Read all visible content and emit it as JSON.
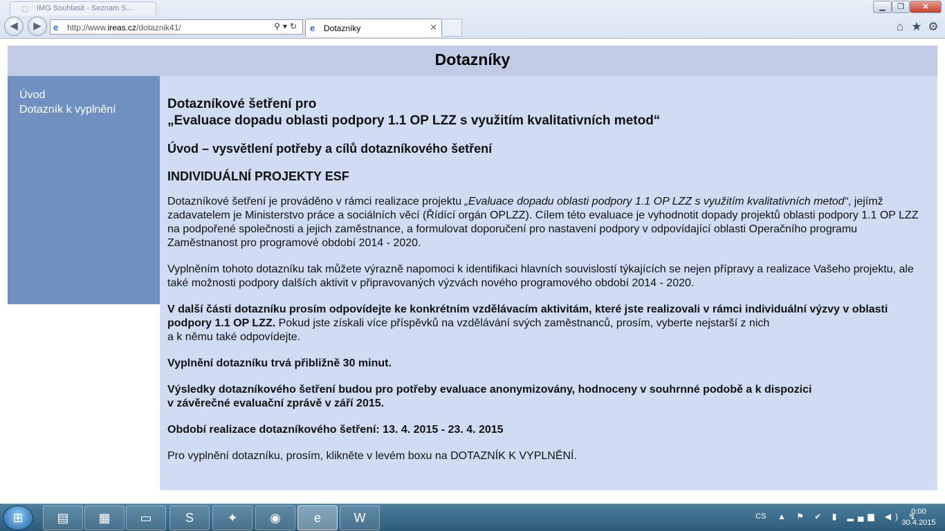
{
  "browser": {
    "ghost_tab_title": "IMG Souhlasit - Seznam S...",
    "address_bar": {
      "url_prefix": "http://www.",
      "url_domain": "ireas.cz",
      "url_path": "/dotaznik41/"
    },
    "active_tab": {
      "title": "Dotazníky",
      "close": "✕"
    },
    "window_buttons": {
      "minimize": "▁",
      "maximize": "❐",
      "close": "✕"
    },
    "nav": {
      "back": "◀",
      "forward": "▶"
    },
    "address_tools": "⚲▾↻",
    "icons": {
      "home": "⌂",
      "favorites": "★",
      "tools": "⚙",
      "favicon": "e"
    }
  },
  "page": {
    "title": "Dotazníky",
    "sidebar": {
      "items": [
        {
          "label": "Úvod"
        },
        {
          "label": "Dotazník k vyplnění"
        }
      ]
    },
    "content": {
      "heading_line1": "Dotazníkové šetření pro",
      "heading_line2": "„Evaluace dopadu oblasti podpory 1.1 OP LZZ s využitím kvalitativních metod“",
      "subheading": "Úvod – vysvětlení potřeby a cílů dotazníkového šetření",
      "section_title": "INDIVIDUÁLNÍ PROJEKTY ESF",
      "p1_start": "Dotazníkové šetření je prováděno v rámci realizace projektu ",
      "p1_italic": "„Evaluace dopadu oblasti podpory 1.1 OP LZZ s využitím kvalitativních metod“",
      "p1_end": ", jejímž zadavatelem je Ministerstvo práce a sociálních věcí (Řídící orgán OPLZZ). Cílem této evaluace je vyhodnotit dopady projektů oblasti podpory 1.1 OP LZZ na podpořené společnosti a jejich zaměstnance, a formulovat doporučení pro nastavení podpory v odpovídající oblasti Operačního programu Zaměstnanost pro programové období 2014 - 2020.",
      "p2": "Vyplněním tohoto dotazníku tak můžete výrazně napomoci k identifikaci hlavních souvislostí týkajících se nejen přípravy a realizace Vašeho projektu, ale také možnosti podpory dalších aktivit v připravovaných výzvách nového programového období 2014 - 2020.",
      "p3_bold": "V další části dotazníku prosím odpovídejte ke konkrétním vzdělávacím aktivitám, které jste realizovali v rámci individuální výzvy v oblasti podpory 1.1 OP LZZ.",
      "p3_normal_line1": " Pokud jste získali více příspěvků na vzdělávání svých zaměstnanců, prosím, vyberte nejstarší z nich",
      "p3_normal_line2": "a k němu také odpovídejte.",
      "p4": "Vyplnění dotazníku trvá přibližně 30 minut.",
      "p5_line1": "Výsledky dotazníkového šetření budou pro potřeby evaluace anonymizovány, hodnoceny v souhrnné podobě a k dispozici",
      "p5_line2": "v závěrečné evaluační zprávě v září 2015.",
      "p6": "Období realizace dotazníkového šetření: 13. 4. 2015 - 23. 4. 2015",
      "p7": "Pro vyplnění dotazníku, prosím, klikněte v levém boxu na DOTAZNÍK K VYPLNĚNÍ."
    }
  },
  "taskbar": {
    "start": "⊞",
    "apps": [
      {
        "name": "explorer",
        "glyph": "▤"
      },
      {
        "name": "calculator",
        "glyph": "▦"
      },
      {
        "name": "scanner",
        "glyph": "▭"
      },
      {
        "name": "skype",
        "glyph": "S"
      },
      {
        "name": "compass",
        "glyph": "✦"
      },
      {
        "name": "firefox",
        "glyph": "◉"
      },
      {
        "name": "internet-explorer",
        "glyph": "e"
      },
      {
        "name": "word",
        "glyph": "W"
      }
    ],
    "tray": {
      "language": "CS",
      "icons": "▲ ⚑ ✔ ▮ ▂▄▆ ◀) ↯",
      "time": "0:00",
      "date": "30.4.2015"
    }
  }
}
